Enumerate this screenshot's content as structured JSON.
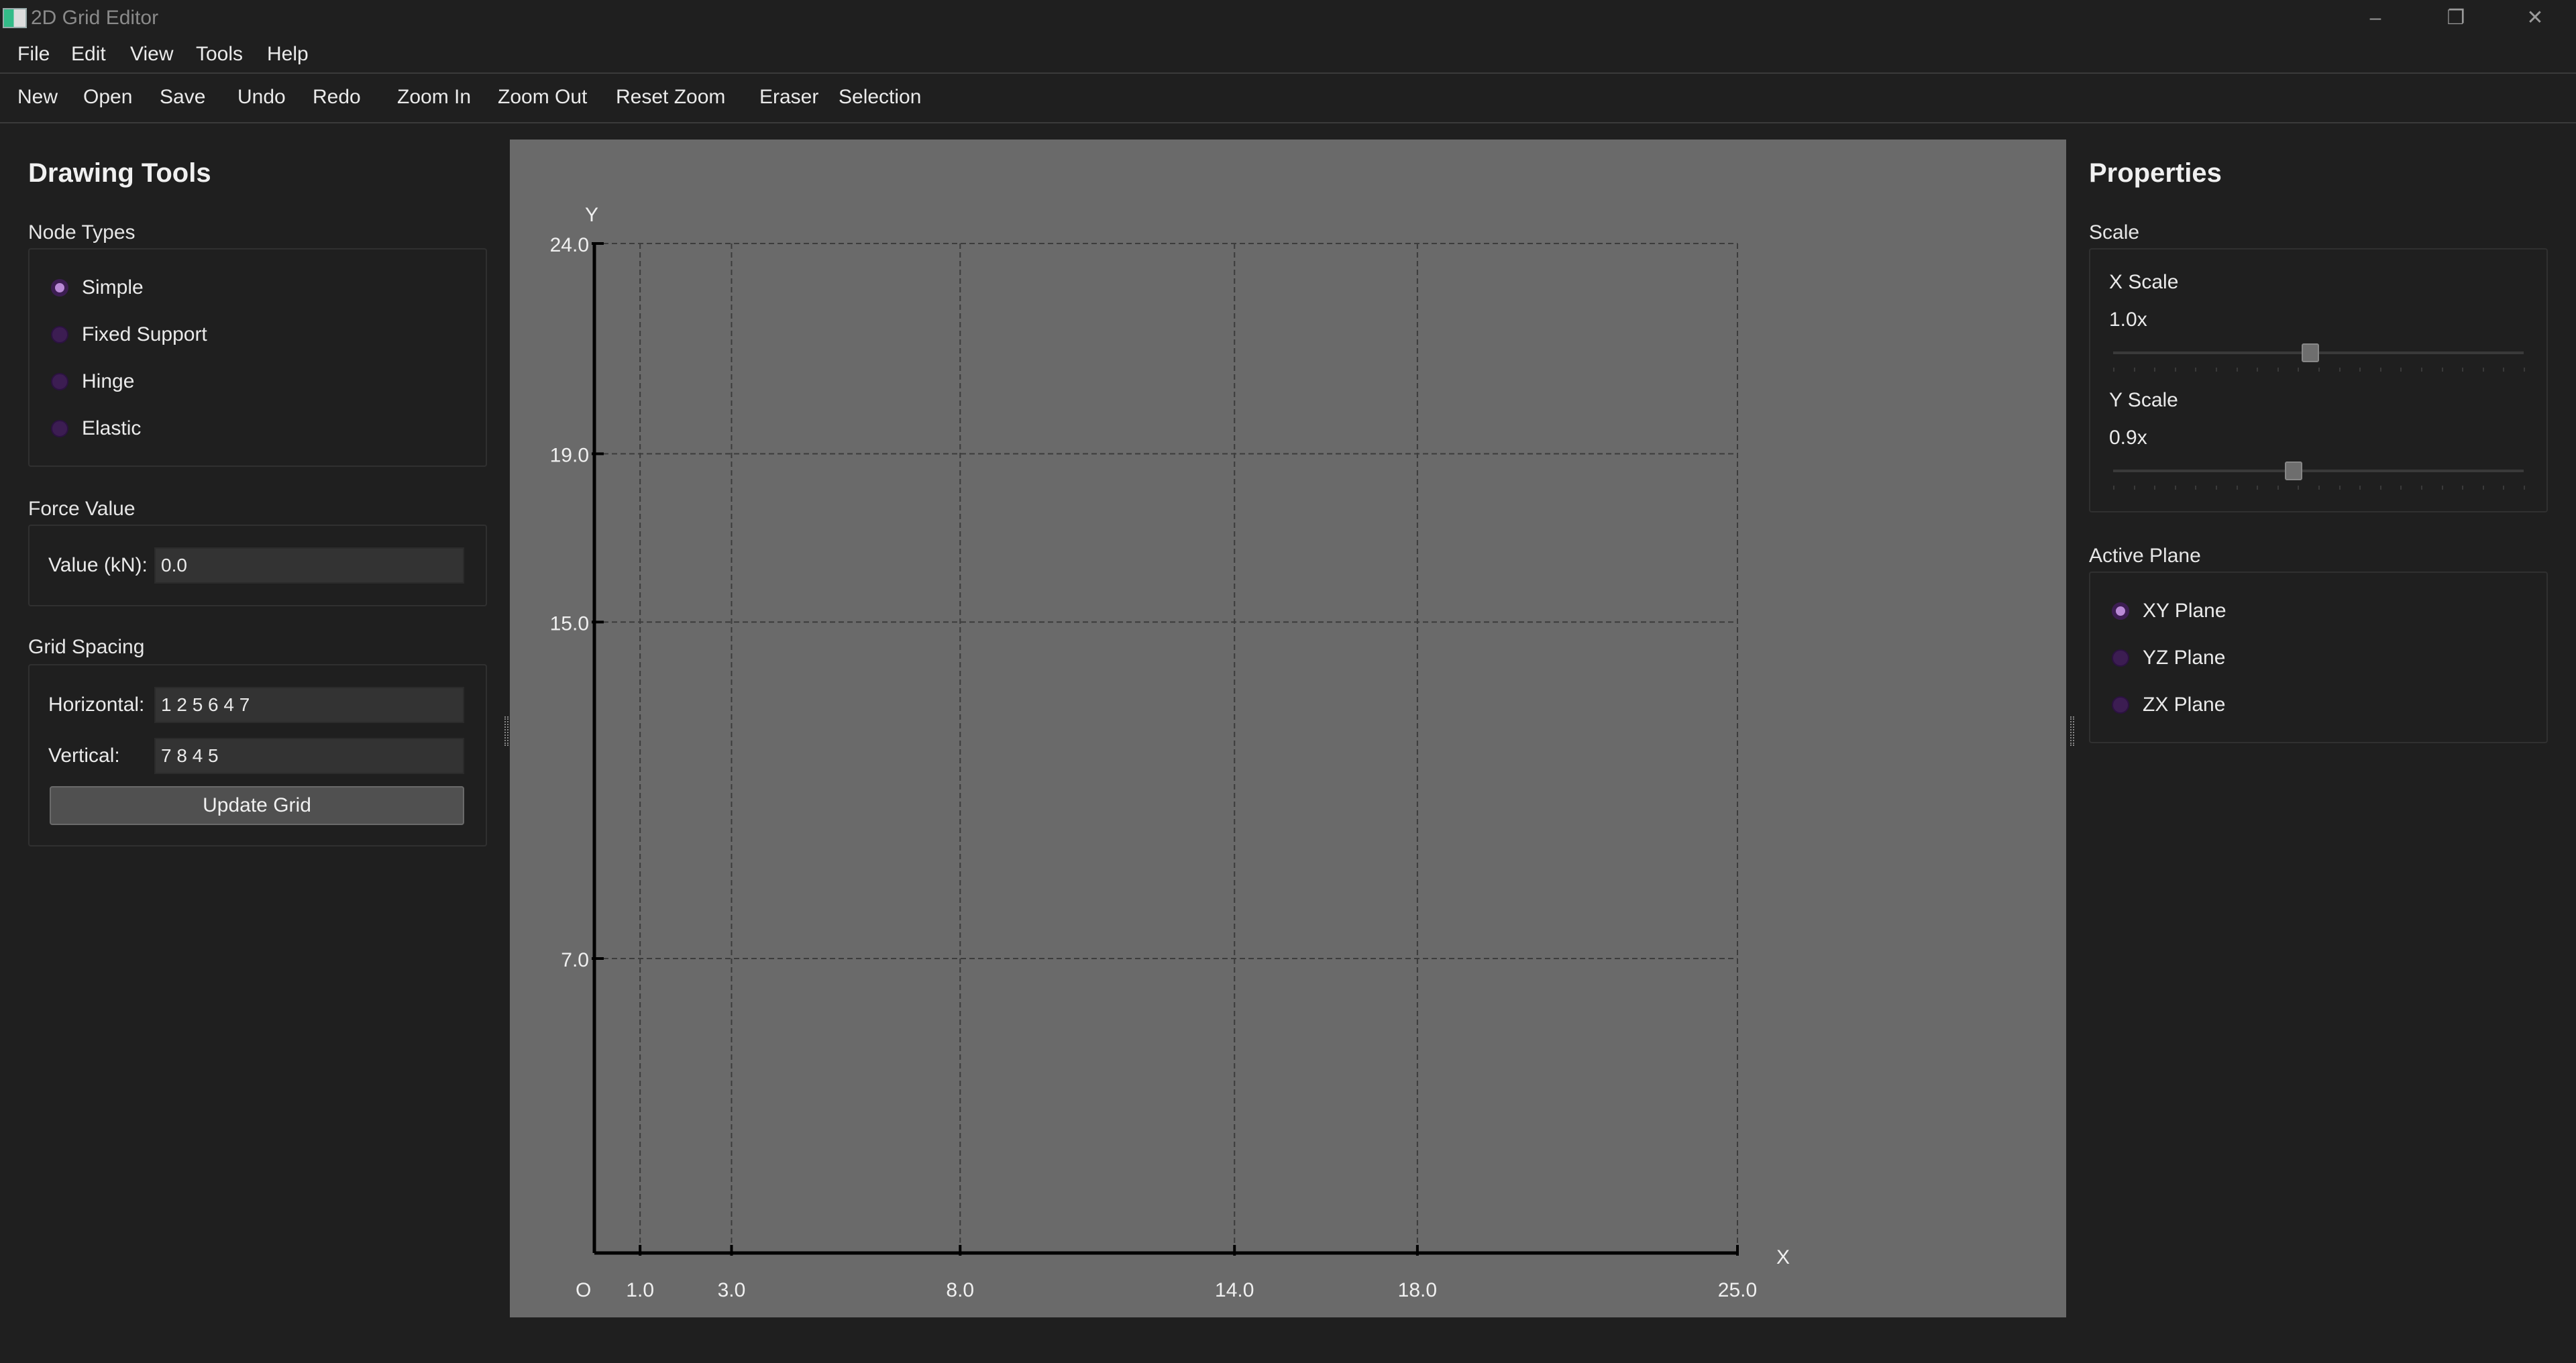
{
  "window": {
    "title": "2D Grid Editor",
    "controls": {
      "minimize": "–",
      "maximize": "❐",
      "close": "✕"
    }
  },
  "menu": {
    "items": [
      "File",
      "Edit",
      "View",
      "Tools",
      "Help"
    ]
  },
  "toolbar": {
    "new": "New",
    "open": "Open",
    "save": "Save",
    "undo": "Undo",
    "redo": "Redo",
    "zoom_in": "Zoom In",
    "zoom_out": "Zoom Out",
    "reset_zoom": "Reset Zoom",
    "eraser": "Eraser",
    "selection": "Selection"
  },
  "left_panel": {
    "title": "Drawing Tools",
    "node_types": {
      "label": "Node Types",
      "options": [
        "Simple",
        "Fixed Support",
        "Hinge",
        "Elastic"
      ],
      "selected": "Simple"
    },
    "force": {
      "label": "Force Value",
      "field_label": "Value (kN):",
      "value": "0.0"
    },
    "grid_spacing": {
      "label": "Grid Spacing",
      "horizontal_label": "Horizontal:",
      "horizontal_value": "1 2 5 6 4 7",
      "vertical_label": "Vertical:",
      "vertical_value": "7 8 4 5",
      "update_button": "Update Grid"
    }
  },
  "right_panel": {
    "title": "Properties",
    "scale": {
      "label": "Scale",
      "x_label": "X Scale",
      "x_value": "1.0x",
      "x_slider_fraction": 0.48,
      "y_label": "Y Scale",
      "y_value": "0.9x",
      "y_slider_fraction": 0.44
    },
    "active_plane": {
      "label": "Active Plane",
      "options": [
        "XY Plane",
        "YZ Plane",
        "ZX Plane"
      ],
      "selected": "XY Plane"
    }
  },
  "canvas": {
    "origin_label": "O",
    "x_axis_label": "X",
    "y_axis_label": "Y",
    "x_ticks": [
      "1.0",
      "3.0",
      "8.0",
      "14.0",
      "18.0",
      "25.0"
    ],
    "y_ticks": [
      "7.0",
      "15.0",
      "19.0",
      "24.0"
    ],
    "colors": {
      "background": "#6a6a6a",
      "axis": "#000000",
      "grid": "#3c3c3c"
    }
  }
}
